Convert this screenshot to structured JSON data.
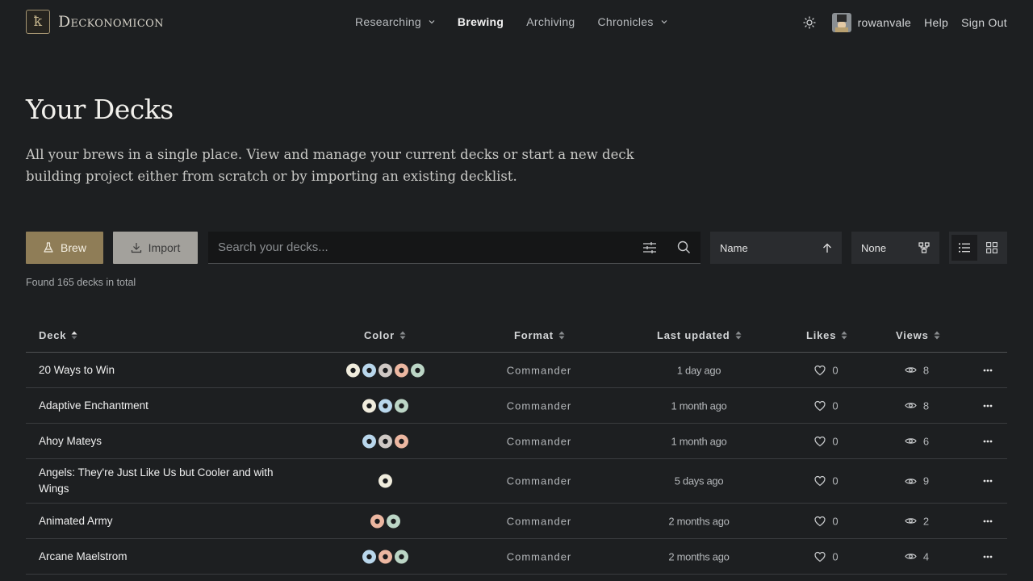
{
  "brand": {
    "logo_glyph": "ꝁ",
    "name": "Deckonomicon"
  },
  "nav": {
    "links": [
      {
        "label": "Researching",
        "dropdown": true,
        "active": false
      },
      {
        "label": "Brewing",
        "dropdown": false,
        "active": true
      },
      {
        "label": "Archiving",
        "dropdown": false,
        "active": false
      },
      {
        "label": "Chronicles",
        "dropdown": true,
        "active": false
      }
    ],
    "theme_icon": "sun-icon",
    "username": "rowanvale",
    "help": "Help",
    "sign_out": "Sign Out"
  },
  "hero": {
    "title": "Your Decks",
    "description": "All your brews in a single place. View and manage your current decks or start a new deck building project either from scratch or by importing an existing decklist."
  },
  "toolbar": {
    "brew_label": "Brew",
    "import_label": "Import",
    "search_placeholder": "Search your decks...",
    "sort_label": "Name",
    "group_label": "None",
    "view_mode": "list"
  },
  "found_text": "Found 165 decks in total",
  "table": {
    "columns": [
      "Deck",
      "Color",
      "Format",
      "Last updated",
      "Likes",
      "Views"
    ],
    "rows": [
      {
        "name": "20 Ways to Win",
        "colors": [
          "W",
          "U",
          "B",
          "R",
          "G"
        ],
        "format": "Commander",
        "updated": "1 day ago",
        "likes": "0",
        "views": "8"
      },
      {
        "name": "Adaptive Enchantment",
        "colors": [
          "W",
          "U",
          "G"
        ],
        "format": "Commander",
        "updated": "1 month ago",
        "likes": "0",
        "views": "8"
      },
      {
        "name": "Ahoy Mateys",
        "colors": [
          "U",
          "B",
          "R"
        ],
        "format": "Commander",
        "updated": "1 month ago",
        "likes": "0",
        "views": "6"
      },
      {
        "name": "Angels: They're Just Like Us but Cooler and with Wings",
        "colors": [
          "W"
        ],
        "format": "Commander",
        "updated": "5 days ago",
        "likes": "0",
        "views": "9"
      },
      {
        "name": "Animated Army",
        "colors": [
          "R",
          "G"
        ],
        "format": "Commander",
        "updated": "2 months ago",
        "likes": "0",
        "views": "2"
      },
      {
        "name": "Arcane Maelstrom",
        "colors": [
          "U",
          "R",
          "G"
        ],
        "format": "Commander",
        "updated": "2 months ago",
        "likes": "0",
        "views": "4"
      }
    ]
  },
  "colors": {
    "brew": "#8f7d57",
    "import": "#a3a19c",
    "background": "#1d1f21"
  }
}
